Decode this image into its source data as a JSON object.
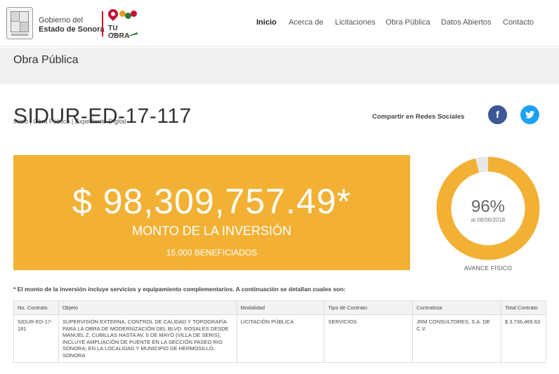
{
  "header": {
    "gov_line1": "Gobierno del",
    "gov_line2": "Estado de Sonora",
    "brand_label": "TU OBRA",
    "nav": [
      "Inicio",
      "Acerca de",
      "Licitaciones",
      "Obra Pública",
      "Datos Abiertos",
      "Contacto"
    ],
    "active_nav": "Inicio"
  },
  "band": {
    "title": "Obra Pública",
    "breadcrumb": "Inicio | Obra Pública | Expediente Digital"
  },
  "project": {
    "id": "SIDUR-ED-17-117",
    "share_label": "Compartir en Redes Sociales",
    "facebook_glyph": "f",
    "twitter_glyph": "t"
  },
  "investment": {
    "amount": "$ 98,309,757.49*",
    "label": "MONTO DE LA INVERSIÓN",
    "beneficiaries": "15,000 BENEFICIADOS"
  },
  "progress": {
    "percent_text": "96%",
    "percent_value": 96,
    "date": "al 08/06/2018",
    "label": "AVANCE FÍSICO"
  },
  "note": "* El monto de la inversión incluye servicios y equipamiento complementarios. A continuación se detallan cuales son:",
  "table": {
    "headers": [
      "No. Contrato",
      "Objeto",
      "Modalidad",
      "Tipo de Contrato",
      "Contratista",
      "Total Contrato"
    ],
    "rows": [
      [
        "SIDUR-ED-17-181",
        "SUPERVISIÓN EXTERNA, CONTROL DE CALIDAD Y TOPOGRAFÍA PARA LA OBRA DE MODERNIZACIÓN DEL BLVD. ROSALES DESDE MANUEL Z. CUBILLAS HASTA AV. 5 DE MAYO (VILLA DE SERIS); INCLUYE AMPLIACIÓN DE PUENTE EN LA SECCIÓN PASEO RIO SONORA; EN LA LOCALIDAD Y MUNICIPIO DE HERMOSILLO, SONORA",
        "LICITACIÓN PÚBLICA",
        "SERVICIOS",
        "JRM CONSULTORES, S.A. DE C.V.",
        "$ 3,736,469.63"
      ]
    ]
  },
  "colors": {
    "accent_orange": "#f2b134",
    "ring_track": "#e8e8e8",
    "facebook": "#3b5998",
    "twitter": "#1da1f2",
    "brand_red": "#c8102e"
  }
}
